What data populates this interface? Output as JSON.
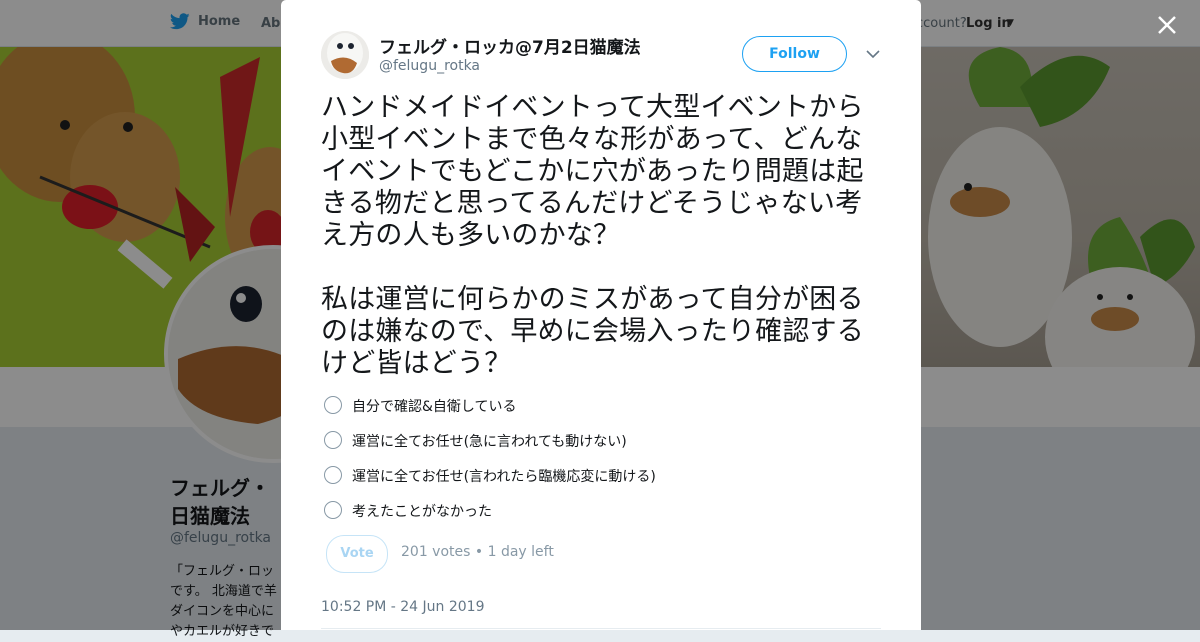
{
  "nav": {
    "home_label": "Home",
    "about_label": "Abo",
    "account_prompt": "ccount?",
    "login_label": "Log in"
  },
  "profile": {
    "name": "フェルグ・\n日猫魔法",
    "handle": "@felugu_rotka",
    "bio": "「フェルグ・ロッ\nです。 北海道で羊\nダイコンを中心に\nやカエルが好きで"
  },
  "tweet": {
    "author_name": "フェルグ・ロッカ@7月2日猫魔法",
    "author_handle": "@felugu_rotka",
    "follow_label": "Follow",
    "text": "ハンドメイドイベントって大型イベントから小型イベントまで色々な形があって、どんなイベントでもどこかに穴があったり問題は起きる物だと思ってるんだけどそうじゃない考え方の人も多いのかな？\n\n私は運営に何らかのミスがあって自分が困るのは嫌なので、早めに会場入ったり確認するけど皆はどう？",
    "poll": {
      "options": [
        "自分で確認&自衛している",
        "運営に全てお任せ(急に言われても動けない)",
        "運営に全てお任せ(言われたら臨機応変に動ける)",
        "考えたことがなかった"
      ],
      "vote_label": "Vote",
      "votes": "201 votes",
      "separator": "•",
      "time_left": "1 day left"
    },
    "timestamp": "10:52 PM - 24 Jun 2019"
  },
  "colors": {
    "accent": "#1da1f2",
    "banner": "#a8ce33",
    "text": "#14171a",
    "muted": "#657786"
  },
  "icons": [
    "twitter-bird-icon",
    "close-icon",
    "chevron-down-icon",
    "caret-down-icon"
  ]
}
